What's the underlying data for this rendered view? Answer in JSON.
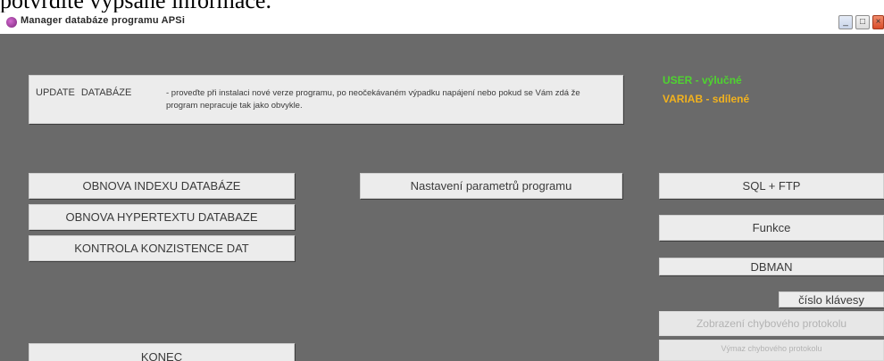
{
  "caption": "potvrdíte vypsané informace.",
  "window": {
    "title": "Manager databáze programu APSi",
    "controls": [
      "_",
      "□",
      "×"
    ]
  },
  "update": {
    "title": "UPDATE DATABÁZE",
    "description": "- proveďte při instalaci nové verze programu, po neočekávaném výpadku napájení nebo pokud se Vám zdá že program nepracuje tak jako obvykle."
  },
  "legend": {
    "user": "USER - výlučné",
    "variab": "VARIAB - sdílené",
    "user_color": "#4fd430",
    "variab_color": "#f2b21e"
  },
  "buttons": {
    "obnova_indexu": "OBNOVA INDEXU DATABÁZE",
    "obnova_hypertextu": "OBNOVA HYPERTEXTU DATABAZE",
    "kontrola": "KONTROLA KONZISTENCE DAT",
    "nastaveni": "Nastavení parametrů programu",
    "sql_ftp": "SQL + FTP",
    "funkce": "Funkce",
    "dbman": "DBMAN",
    "cislo_klavesy": "číslo klávesy",
    "zobrazeni": "Zobrazení chybového protokolu",
    "vymaz": "Výmaz chybového protokolu",
    "konec": "KONEC"
  },
  "colors": {
    "background": "#6a6a6a",
    "button": "#ececec"
  }
}
